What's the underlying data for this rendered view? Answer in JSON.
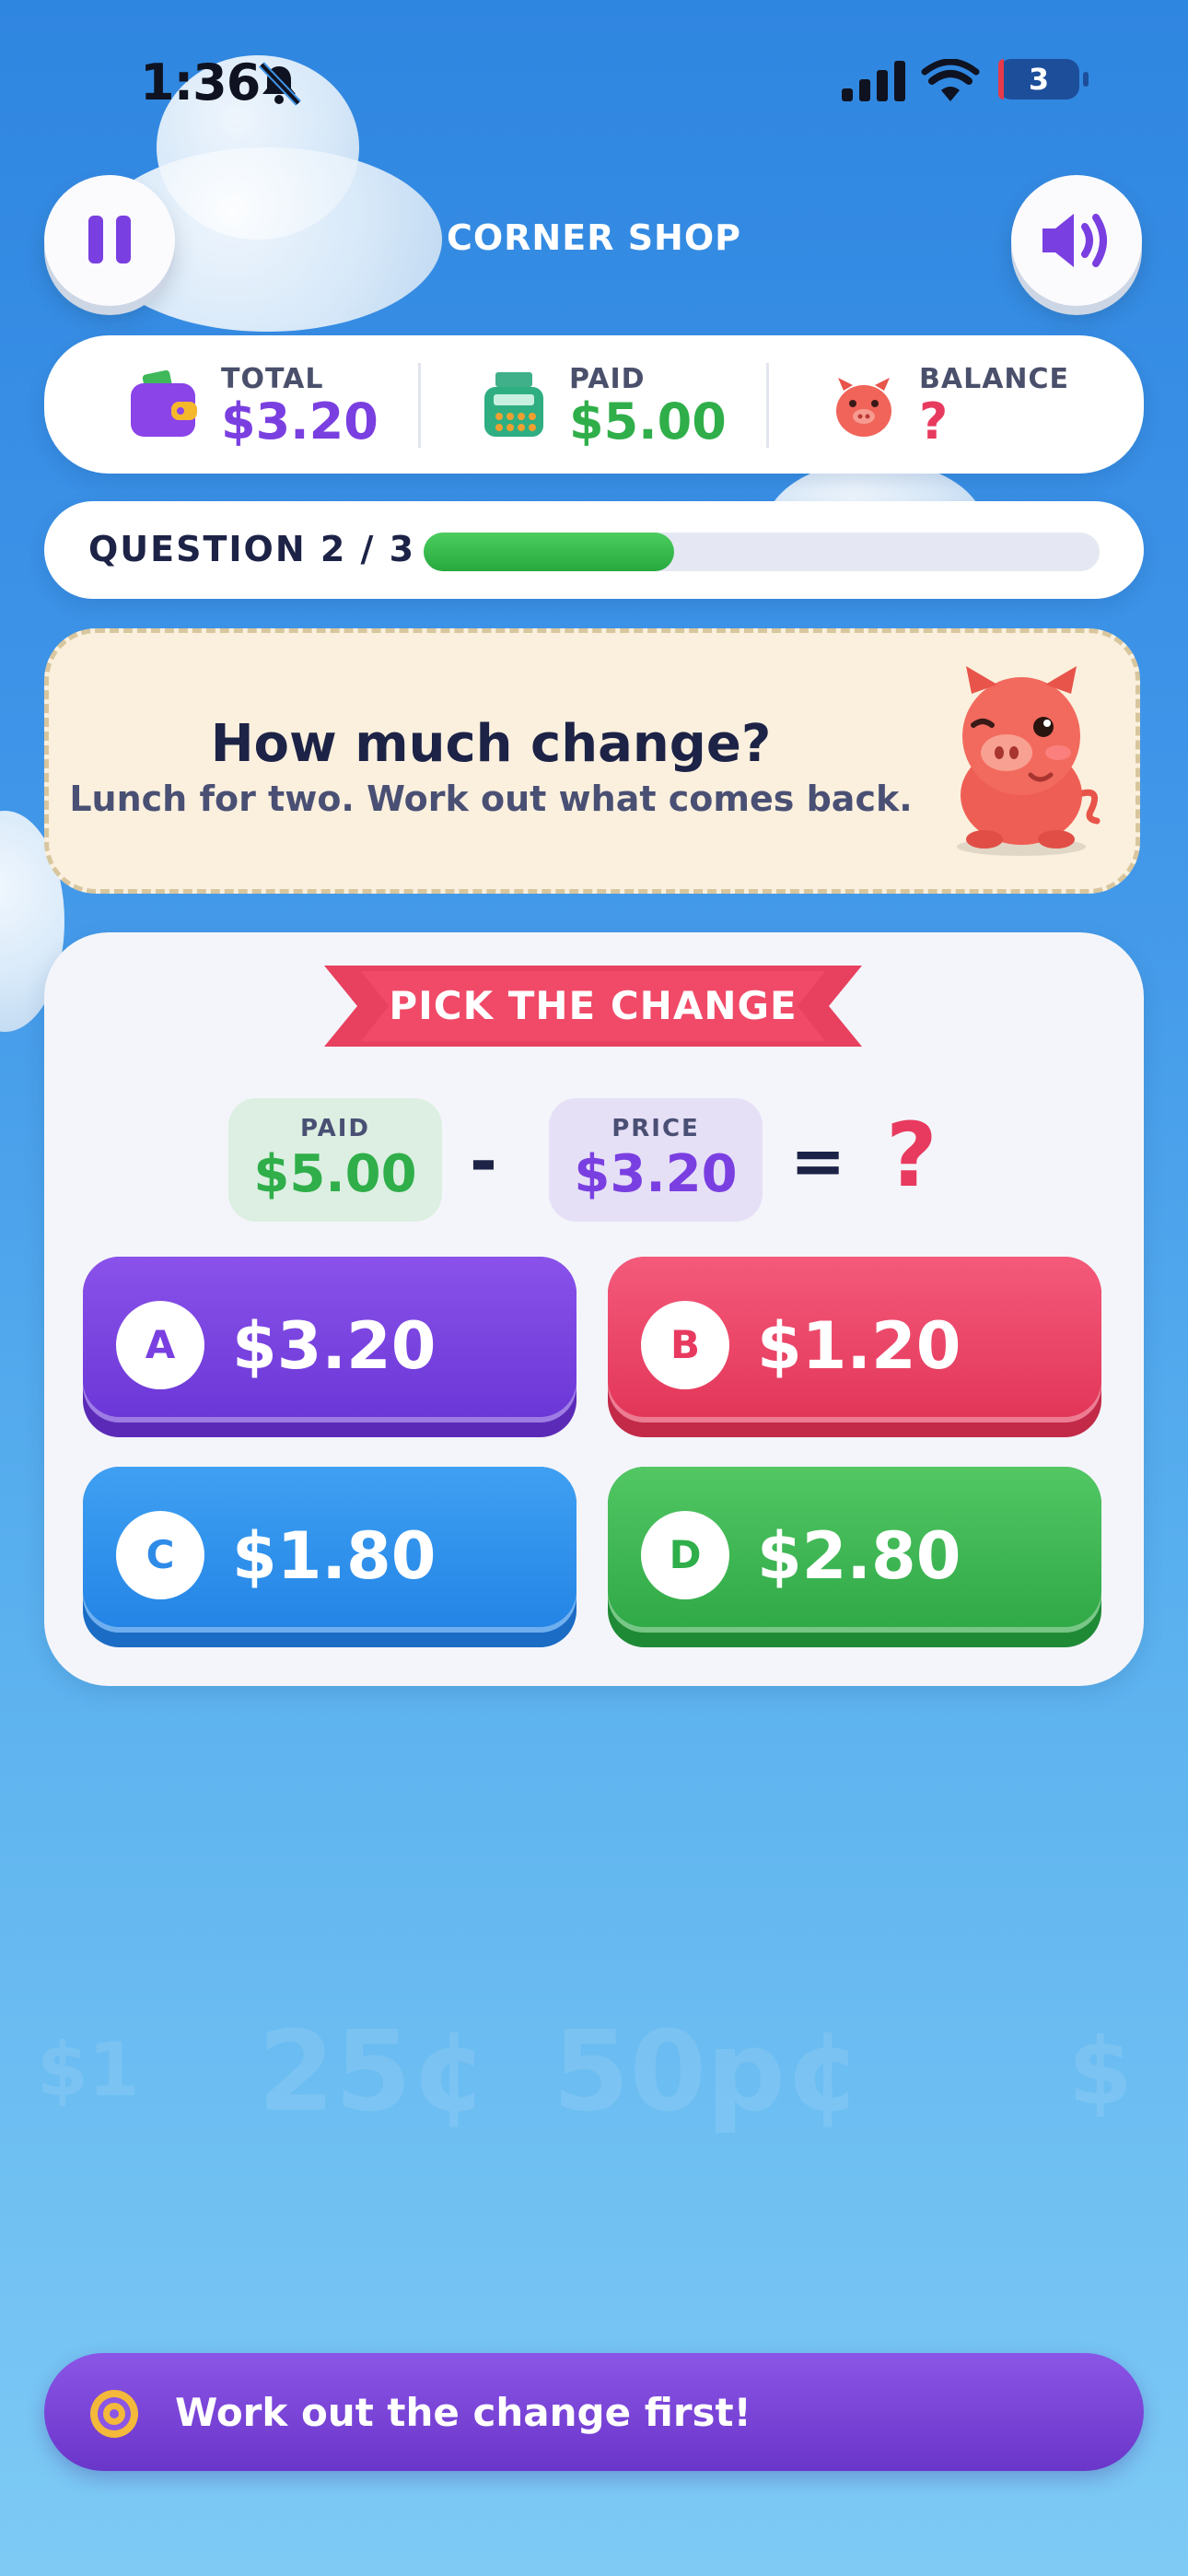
{
  "status_bar": {
    "time": "1:36",
    "battery": "3"
  },
  "header": {
    "title": "CORNER SHOP"
  },
  "stats": [
    {
      "label": "TOTAL",
      "value": "$3.20",
      "color": "#7a3fe0"
    },
    {
      "label": "PAID",
      "value": "$5.00",
      "color": "#2fae49"
    },
    {
      "label": "BALANCE",
      "value": "?",
      "color": "#e83a5f"
    }
  ],
  "progress": {
    "label": "QUESTION  2 / 3",
    "fraction": 0.37
  },
  "prompt": {
    "title": "How much change?",
    "subtitle": "Lunch for two. Work out what comes back."
  },
  "panel": {
    "ribbon": "PICK THE CHANGE",
    "equation": {
      "paid_label": "PAID",
      "paid_value": "$5.00",
      "minus": "-",
      "price_label": "PRICE",
      "price_value": "$3.20",
      "equals": "=",
      "unknown": "?"
    },
    "answers": [
      {
        "letter": "A",
        "value": "$3.20"
      },
      {
        "letter": "B",
        "value": "$1.20"
      },
      {
        "letter": "C",
        "value": "$1.80"
      },
      {
        "letter": "D",
        "value": "$2.80"
      }
    ]
  },
  "background_words": [
    "$1",
    "25¢",
    "50p¢",
    "$"
  ],
  "toast": {
    "message": "Work out the change first!"
  },
  "colors": {
    "purple": "#7a3fe0",
    "pink": "#e83a5f",
    "blue": "#2f8be8",
    "green": "#2fae49",
    "navy": "#1d2346"
  }
}
